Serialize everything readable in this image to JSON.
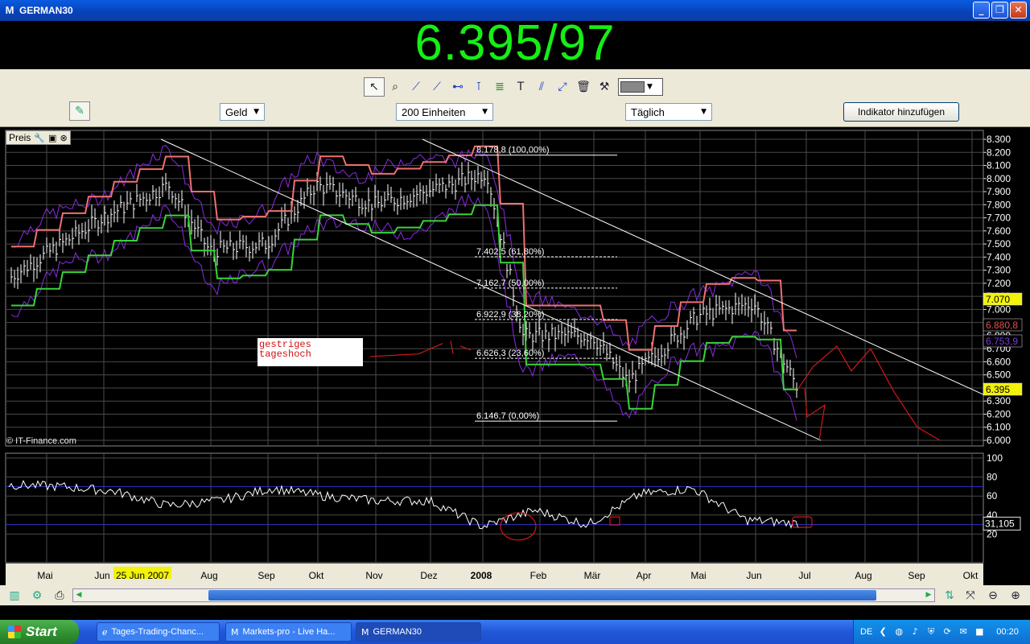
{
  "window": {
    "title": "GERMAN30",
    "icon": "m-logo-icon"
  },
  "quote": {
    "price": "6.395/97"
  },
  "toolbar": {
    "tools": [
      "cursor-icon",
      "zoom-icon",
      "line-icon",
      "trendline-icon",
      "horizontal-line-icon",
      "vertical-line-icon",
      "fibonacci-icon",
      "text-icon",
      "parallel-lines-icon",
      "arrow-icon",
      "trash-icon",
      "tools-icon"
    ],
    "color_swatch": "#888888"
  },
  "controls": {
    "price_type": "Geld",
    "units": "200 Einheiten",
    "interval": "Täglich",
    "add_indicator": "Indikator hinzufügen"
  },
  "price_panel": {
    "label": "Preis",
    "copyright": "© IT-Finance.com",
    "note": [
      "gestriges",
      "tageshoch"
    ],
    "y_ticks": [
      "8.300",
      "8.200",
      "8.100",
      "8.000",
      "7.900",
      "7.800",
      "7.700",
      "7.600",
      "7.500",
      "7.400",
      "7.300",
      "7.200",
      "7.100",
      "7.000",
      "6.900",
      "6.800",
      "6.700",
      "6.600",
      "6.500",
      "6.400",
      "6.300",
      "6.200",
      "6.100",
      "6.000"
    ],
    "value_tags": [
      {
        "text": "7.070",
        "bg": "#f2f20a",
        "fg": "#000000"
      },
      {
        "text": "6.880,8",
        "bg": "#000000",
        "fg": "#e05050"
      },
      {
        "text": "6.753,9",
        "bg": "#000000",
        "fg": "#7a3ae0"
      },
      {
        "text": "6.395",
        "bg": "#f2f20a",
        "fg": "#000000"
      }
    ],
    "fib_levels": [
      {
        "label": "8.178,8 (100,00%)",
        "value": 8178.8
      },
      {
        "label": "7.402,5 (61,80%)",
        "value": 7402.5
      },
      {
        "label": "7.162,7 (50,00%)",
        "value": 7162.7
      },
      {
        "label": "6.922,9 (38,20%)",
        "value": 6922.9
      },
      {
        "label": "6.626,3 (23,60%)",
        "value": 6626.3
      },
      {
        "label": "6.146,7 (0,00%)",
        "value": 6146.7
      }
    ]
  },
  "rsi_panel": {
    "y_ticks": [
      "100",
      "80",
      "60",
      "40",
      "20"
    ],
    "value_tag": "31,105"
  },
  "x_axis": {
    "labels": [
      "Mai",
      "Jun",
      "25 Jun 2007",
      "Aug",
      "Sep",
      "Okt",
      "Nov",
      "Dez",
      "2008",
      "Feb",
      "Mär",
      "Apr",
      "Mai",
      "Jun",
      "Jul",
      "Aug",
      "Sep",
      "Okt"
    ]
  },
  "chart_data": {
    "type": "line",
    "title": "",
    "ylim": [
      6000,
      8300
    ],
    "x": [
      "Mai",
      "Jun",
      "Jul",
      "Aug",
      "Sep",
      "Okt",
      "Nov",
      "Dez",
      "2008",
      "Feb",
      "Mär",
      "Apr",
      "Mai",
      "Jun",
      "Jul"
    ],
    "series": [
      {
        "name": "",
        "values": [
          7250,
          7700,
          7950,
          7450,
          7500,
          7950,
          7800,
          7950,
          8050,
          6800,
          6800,
          6450,
          6950,
          7050,
          6395
        ]
      }
    ],
    "rsi": {
      "ylim": [
        0,
        100
      ],
      "levels": [
        70,
        30
      ],
      "values": [
        72,
        70,
        65,
        50,
        55,
        68,
        60,
        55,
        55,
        28,
        45,
        30,
        62,
        68,
        35,
        31
      ]
    },
    "grid": true
  },
  "bottom": {
    "left_icons": [
      "chart-settings-icon",
      "indicator-icon",
      "print-icon"
    ],
    "right_icons": [
      "compare-icon",
      "fit-icon",
      "zoom-out-icon",
      "zoom-in-icon"
    ]
  },
  "taskbar": {
    "start": "Start",
    "tasks": [
      "Tages-Trading-Chanc...",
      "Markets-pro - Live Ha...",
      "GERMAN30"
    ],
    "lang": "DE",
    "time": "00:20"
  }
}
